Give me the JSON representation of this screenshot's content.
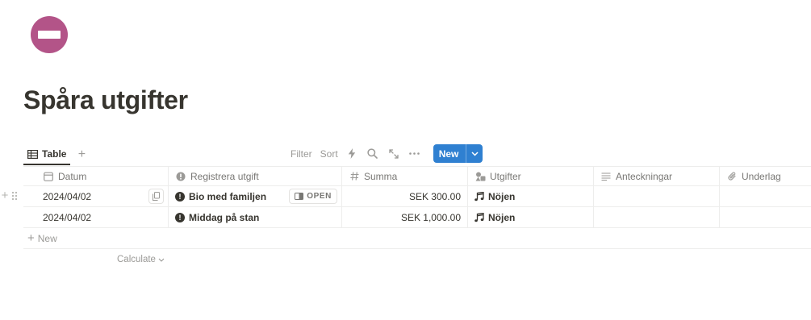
{
  "page": {
    "title": "Spåra utgifter",
    "icon": "no-entry-icon",
    "icon_color": "#b35488"
  },
  "view_tabs": {
    "items": [
      {
        "label": "Table",
        "icon": "table-icon"
      }
    ],
    "add_icon": "+"
  },
  "toolbar": {
    "filter_label": "Filter",
    "sort_label": "Sort",
    "new_label": "New",
    "accent": "#2f80d1"
  },
  "table": {
    "columns": [
      {
        "label": "Datum",
        "icon": "calendar-icon"
      },
      {
        "label": "Registrera utgift",
        "icon": "title-icon"
      },
      {
        "label": "Summa",
        "icon": "number-icon"
      },
      {
        "label": "Utgifter",
        "icon": "select-icon"
      },
      {
        "label": "Anteckningar",
        "icon": "text-icon"
      },
      {
        "label": "Underlag",
        "icon": "paperclip-icon"
      }
    ],
    "rows": [
      {
        "datum": "2024/04/02",
        "utgift": "Bio med familjen",
        "summa": "SEK 300.00",
        "kategori": "Nöjen",
        "anteckningar": "",
        "underlag": ""
      },
      {
        "datum": "2024/04/02",
        "utgift": "Middag på stan",
        "summa": "SEK 1,000.00",
        "kategori": "Nöjen",
        "anteckningar": "",
        "underlag": ""
      }
    ],
    "open_label": "OPEN",
    "new_row_label": "New",
    "calculate_label": "Calculate"
  }
}
